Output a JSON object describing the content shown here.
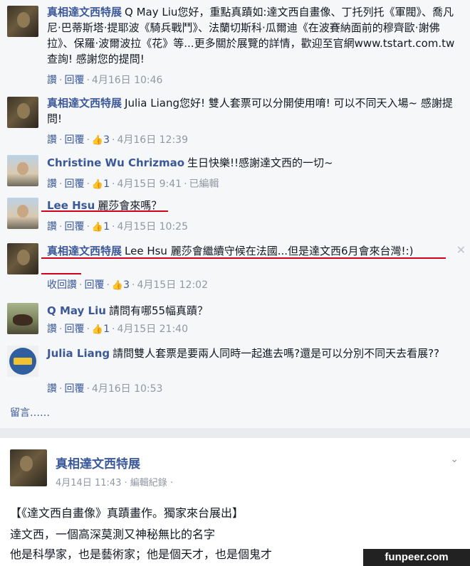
{
  "comments": [
    {
      "author": "真相達文西特展",
      "text": "Q May Liu您好，重點真蹟如:達文西自畫像、丁托列托《軍閥》、喬凡尼·巴蒂斯塔·提耶波《騎兵戰鬥》、法蘭切斯科·瓜爾迪《在波賽納面前的穆齊歐·謝佛拉》、保羅·波爾波拉《花》等...更多關於展覽的詳情，歡迎至官網www.tstart.com.tw 查詢! 感謝您的提問!",
      "like": "讚",
      "reply": "回覆",
      "likes": "",
      "time": "4月16日 10:46"
    },
    {
      "author": "真相達文西特展",
      "text": "Julia Liang您好! 雙人套票可以分開使用唷! 可以不同天入場~ 感謝提問!",
      "like": "讚",
      "reply": "回覆",
      "likes": "3",
      "time": "4月16日 12:39"
    },
    {
      "author": "Christine Wu Chrizmao",
      "text": "生日快樂!!感謝達文西的一切~",
      "like": "讚",
      "reply": "回覆",
      "likes": "1",
      "time": "4月15日 9:41",
      "edited": "已編輯"
    },
    {
      "author": "Lee Hsu",
      "text": "麗莎會來嗎？",
      "like": "讚",
      "reply": "回覆",
      "likes": "1",
      "time": "4月15日 10:25"
    },
    {
      "author": "真相達文西特展",
      "text": "Lee Hsu 麗莎會繼續守候在法國...但是達文西6月會來台灣!:)",
      "like": "收回讚",
      "reply": "回覆",
      "likes": "3",
      "time": "4月15日 12:02"
    },
    {
      "author": "Q May Liu",
      "text": "請問有哪55幅真蹟？",
      "like": "讚",
      "reply": "回覆",
      "likes": "1",
      "time": "4月15日 21:40"
    },
    {
      "author": "Julia Liang",
      "text": "請問雙人套票是要兩人同時一起進去嗎?還是可以分別不同天去看展??",
      "like": "讚",
      "reply": "回覆",
      "likes": "",
      "time": "4月16日 10:53"
    }
  ],
  "view_more": "留言……",
  "post": {
    "page_name": "真相達文西特展",
    "meta": "4月14日 11:43 · 編輯紀錄 ·",
    "headline": "【《達文西自畫像》真蹟畫作。獨家來台展出】",
    "body_line1": "達文西，一個高深莫測又神秘無比的名字",
    "body_line2": "他是科學家，也是藝術家；他是個天才，也是個鬼才"
  },
  "watermark": "funpeer.com",
  "icons": {
    "like": "thumbs-up-icon",
    "close": "close-icon",
    "chevron": "chevron-down-icon"
  },
  "colors": {
    "link": "#3b5998",
    "meta": "#9197a3",
    "underline": "#d0021b"
  }
}
